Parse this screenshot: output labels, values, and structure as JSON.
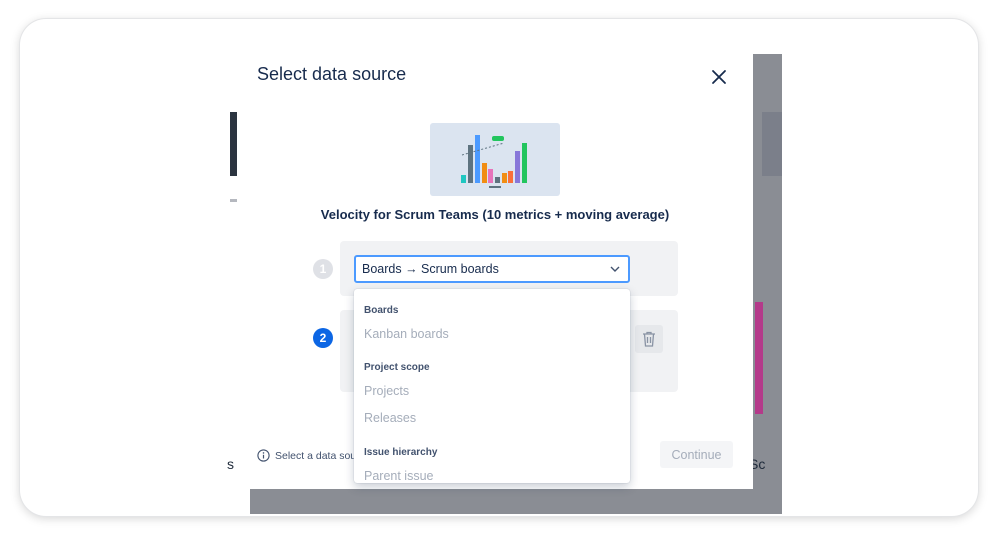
{
  "modal": {
    "title": "Select data source",
    "template_name": "Velocity for Scrum Teams (10 metrics + moving average)",
    "step1_number": "1",
    "step2_number": "2",
    "selected_source": "Boards → Scrum boards",
    "hint_text": "Select a data sour",
    "continue_label": "Continue"
  },
  "dropdown": {
    "groups": [
      {
        "heading": "Boards",
        "options": [
          "Kanban boards"
        ]
      },
      {
        "heading": "Project scope",
        "options": [
          "Projects",
          "Releases"
        ]
      },
      {
        "heading": "Issue hierarchy",
        "options": [
          "Parent issue"
        ]
      }
    ]
  },
  "background": {
    "left_fragment": "s",
    "right_fragment": "Sc"
  },
  "colors": {
    "accent": "#0c66e4",
    "focus_border": "#4c9aff",
    "text_primary": "#172b4d",
    "disabled_text": "#a5adba"
  }
}
